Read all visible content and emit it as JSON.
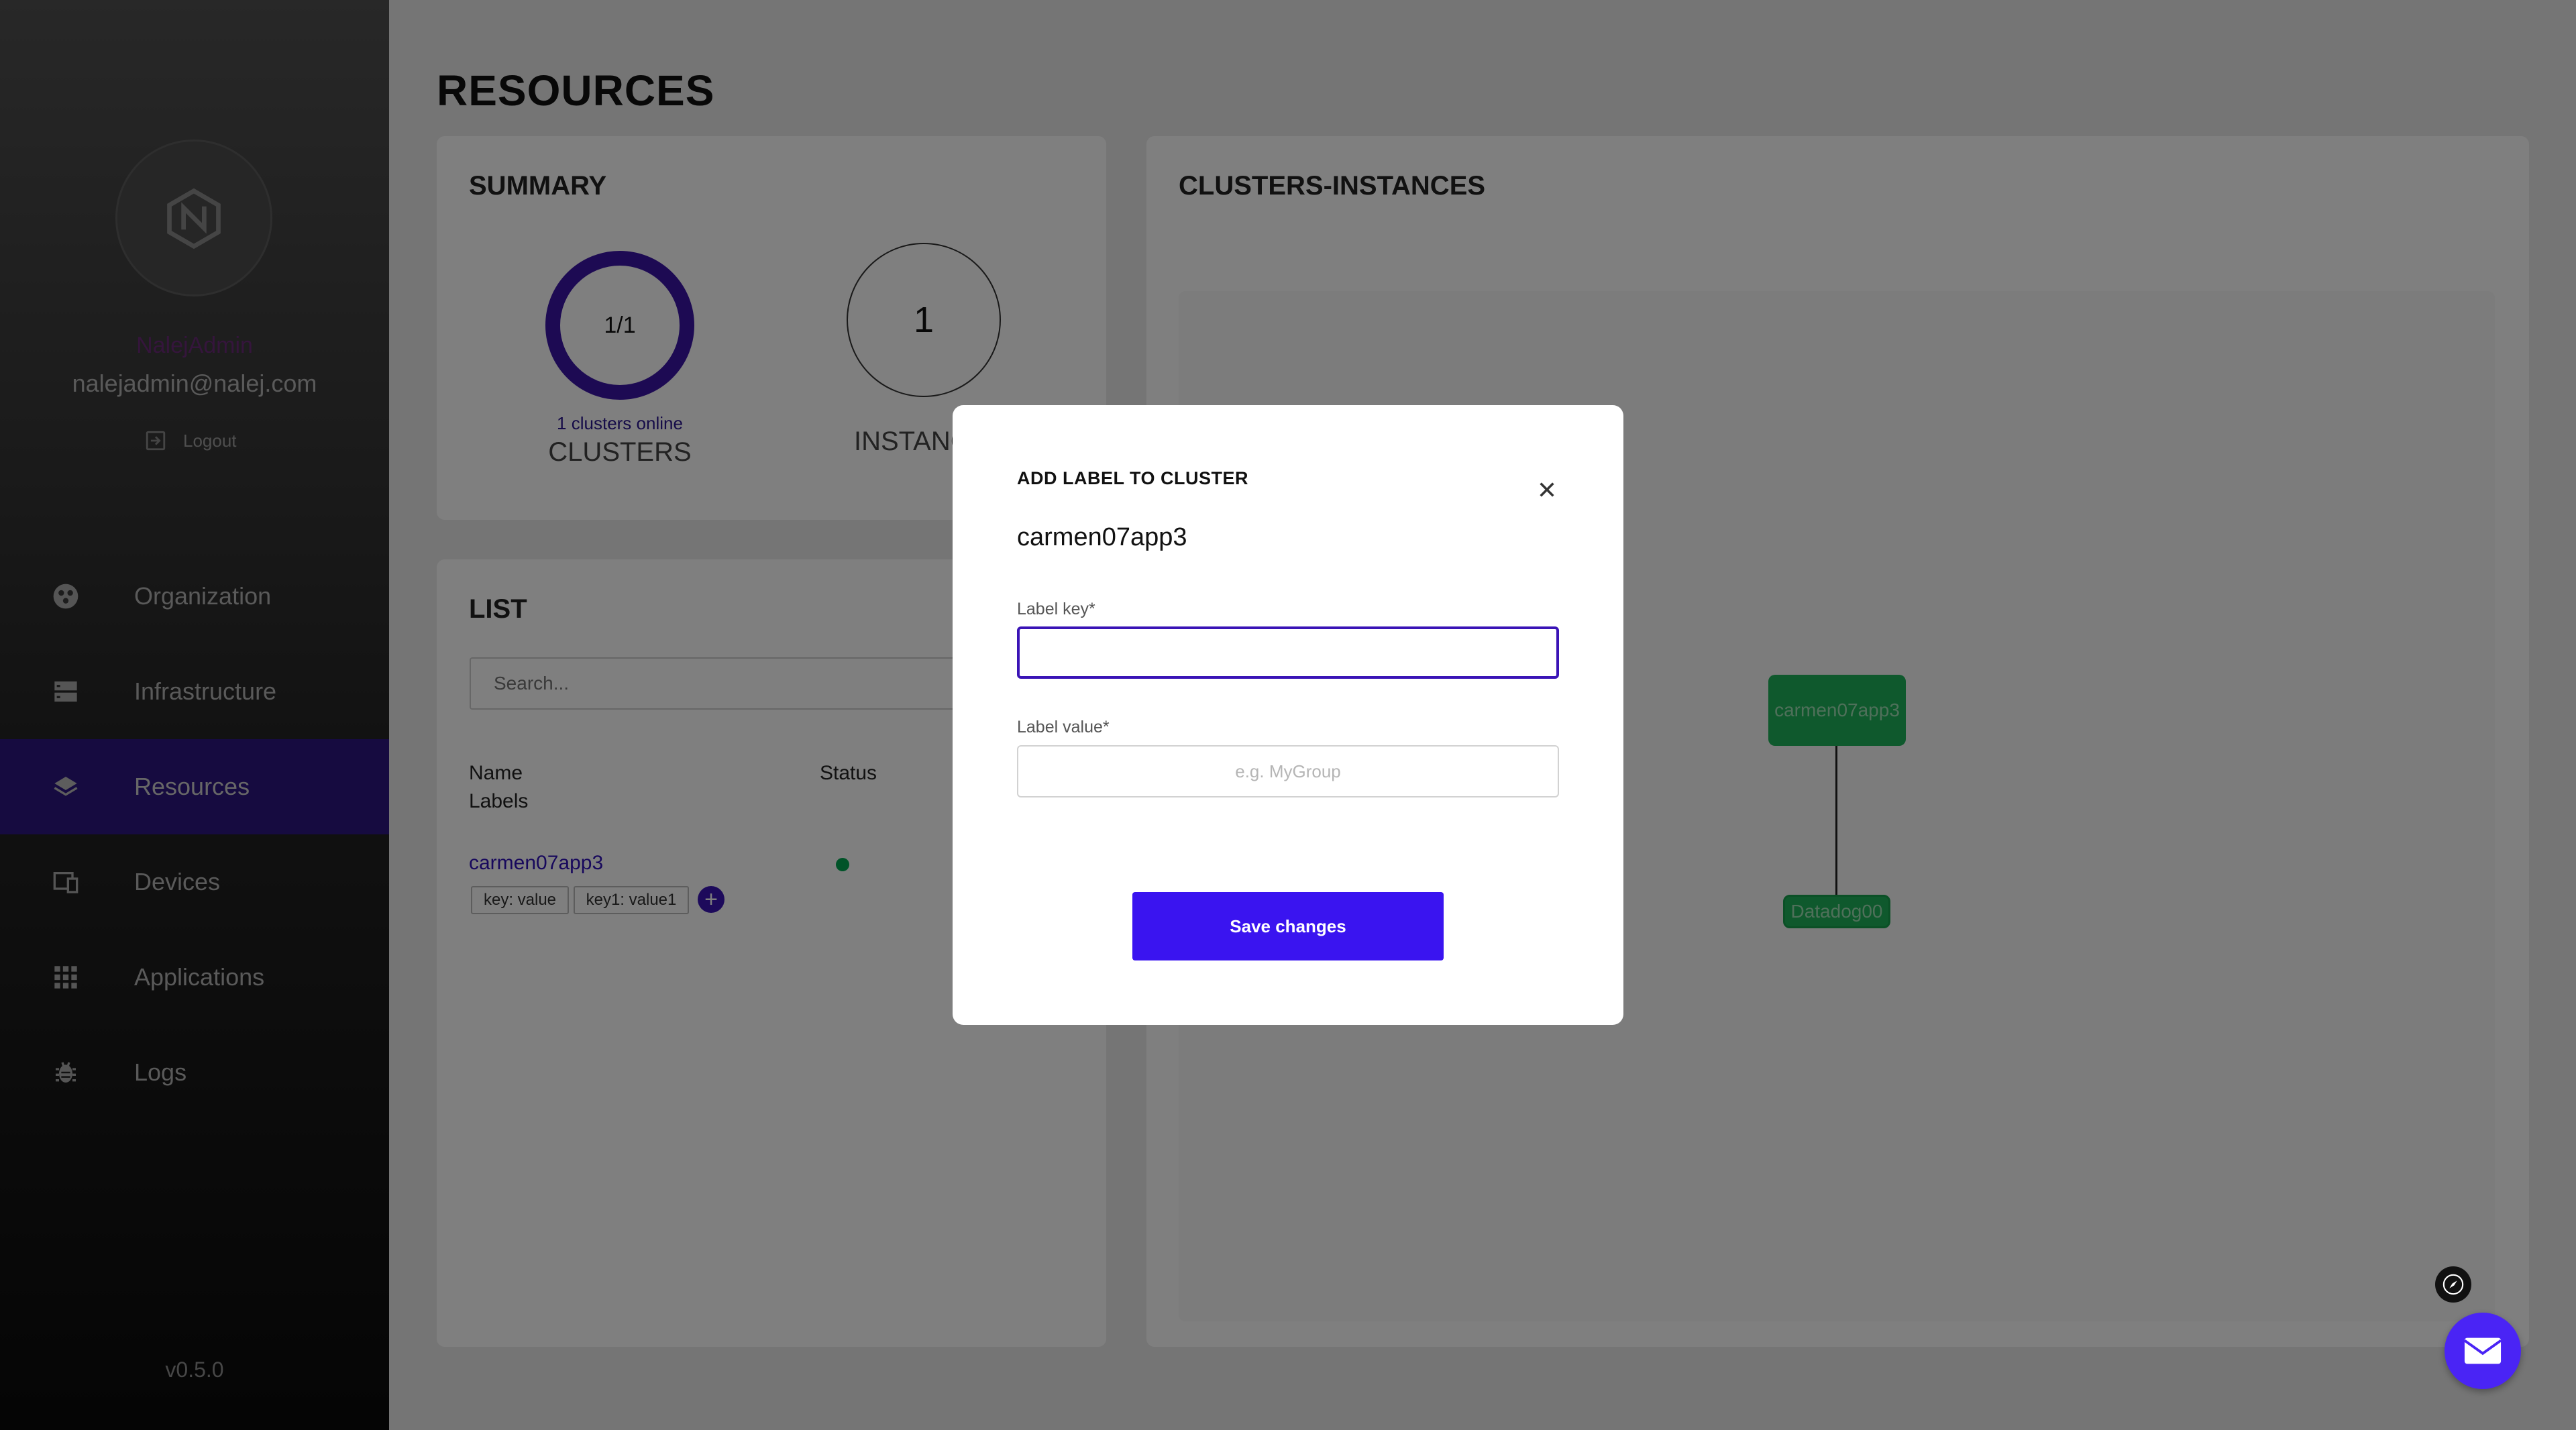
{
  "colors": {
    "accent": "#3a14f0",
    "active_nav": "#2c1680",
    "status_online": "#00a651",
    "node": "#1fb25a"
  },
  "profile": {
    "username": "NalejAdmin",
    "email": "nalejadmin@nalej.com",
    "logout_label": "Logout",
    "logo_icon": "nalej-logo-icon"
  },
  "nav": {
    "items": [
      {
        "label": "Organization",
        "icon": "organization-icon",
        "active": false
      },
      {
        "label": "Infrastructure",
        "icon": "infrastructure-icon",
        "active": false
      },
      {
        "label": "Resources",
        "icon": "resources-icon",
        "active": true
      },
      {
        "label": "Devices",
        "icon": "devices-icon",
        "active": false
      },
      {
        "label": "Applications",
        "icon": "applications-icon",
        "active": false
      },
      {
        "label": "Logs",
        "icon": "logs-icon",
        "active": false
      }
    ]
  },
  "version": "v0.5.0",
  "page": {
    "title": "RESOURCES"
  },
  "summary": {
    "title": "SUMMARY",
    "clusters": {
      "value": "1/1",
      "sub": "1 clusters online",
      "label": "CLUSTERS",
      "online_fraction": 1
    },
    "instances": {
      "value": "1",
      "label": "INSTANC"
    }
  },
  "list": {
    "title": "LIST",
    "search_placeholder": "Search...",
    "headers": {
      "name": "Name",
      "labels": "Labels",
      "status": "Status"
    },
    "rows": [
      {
        "name": "carmen07app3",
        "status": "online",
        "labels": [
          "key: value",
          "key1: value1"
        ]
      }
    ],
    "add_label_glyph": "+"
  },
  "clusters_instances": {
    "title": "CLUSTERS-INSTANCES",
    "nodes": {
      "cluster": "carmen07app3",
      "instance": "Datadog00"
    }
  },
  "modal": {
    "title": "ADD LABEL TO CLUSTER",
    "subtitle": "carmen07app3",
    "key_label": "Label key*",
    "key_value": "",
    "value_label": "Label value*",
    "value_placeholder": "e.g. MyGroup",
    "save_label": "Save changes"
  },
  "widgets": {
    "compass_icon": "compass-icon",
    "chat_icon": "mail-icon"
  }
}
